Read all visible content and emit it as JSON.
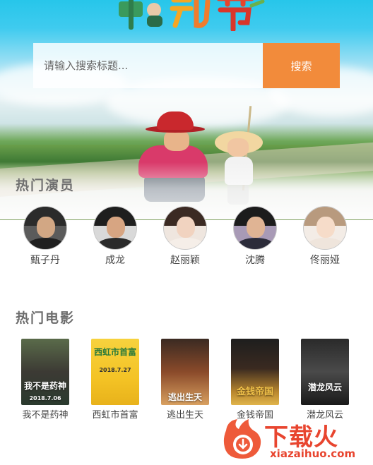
{
  "logo": {
    "text": "中动节"
  },
  "search": {
    "placeholder": "请输入搜索标题...",
    "button_label": "搜索"
  },
  "sections": {
    "actors_title": "热门演员",
    "movies_title": "热门电影"
  },
  "actors": [
    {
      "name": "甄子丹"
    },
    {
      "name": "成龙"
    },
    {
      "name": "赵丽颖"
    },
    {
      "name": "沈腾"
    },
    {
      "name": "佟丽娅"
    }
  ],
  "movies": [
    {
      "title": "我不是药神",
      "poster_text": "我不是药神",
      "poster_date": "2018.7.06"
    },
    {
      "title": "西虹市首富",
      "poster_text": "西虹市首富",
      "poster_date": "2018.7.27"
    },
    {
      "title": "逃出生天",
      "poster_text": "逃出生天",
      "poster_date": ""
    },
    {
      "title": "金钱帝国",
      "poster_text": "金钱帝国",
      "poster_date": ""
    },
    {
      "title": "潜龙风云",
      "poster_text": "潜龙风云",
      "poster_date": ""
    }
  ],
  "watermark": {
    "brand": "下载火",
    "url": "xiazaihuo.com"
  },
  "colors": {
    "search_button": "#f28b3b",
    "section_title": "#6d6d6d",
    "watermark": "#e8452f"
  }
}
